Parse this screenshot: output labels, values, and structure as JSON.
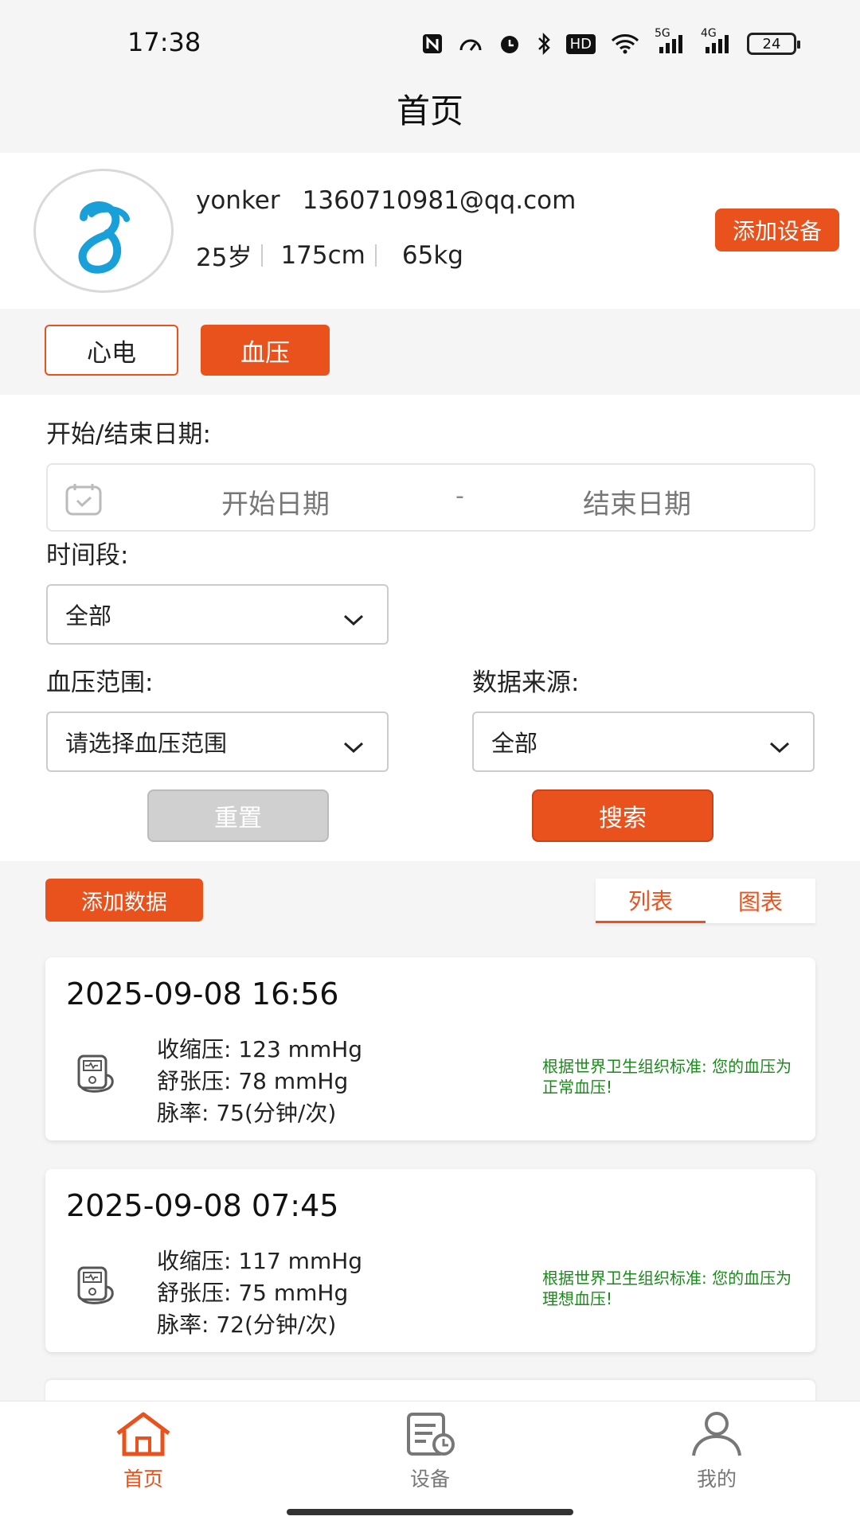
{
  "status_bar": {
    "time": "17:38",
    "battery": "24",
    "hd": "HD",
    "net5g": "5G",
    "net4g": "4G"
  },
  "header": {
    "title": "首页"
  },
  "profile": {
    "name": "yonker",
    "email": "1360710981@qq.com",
    "age": "25岁",
    "height": "175cm",
    "weight": "65kg",
    "add_device_label": "添加设备"
  },
  "tabs": [
    {
      "label": "心电",
      "active": false
    },
    {
      "label": "血压",
      "active": true
    }
  ],
  "filters": {
    "date_label": "开始/结束日期:",
    "start_placeholder": "开始日期",
    "dash": "-",
    "end_placeholder": "结束日期",
    "period_label": "时间段:",
    "period_value": "全部",
    "bp_range_label": "血压范围:",
    "bp_range_value": "请选择血压范围",
    "source_label": "数据来源:",
    "source_value": "全部",
    "reset_label": "重置",
    "search_label": "搜索"
  },
  "list_header": {
    "add_data_label": "添加数据",
    "view_list": "列表",
    "view_chart": "图表"
  },
  "records": [
    {
      "datetime": "2025-09-08 16:56",
      "systolic": "收缩压:  123 mmHg",
      "diastolic": "舒张压:  78 mmHg",
      "pulse": "脉率:  75(分钟/次)",
      "message": "根据世界卫生组织标准: 您的血压为正常血压!"
    },
    {
      "datetime": "2025-09-08 07:45",
      "systolic": "收缩压:  117 mmHg",
      "diastolic": "舒张压:  75 mmHg",
      "pulse": "脉率:  72(分钟/次)",
      "message": "根据世界卫生组织标准: 您的血压为理想血压!"
    }
  ],
  "bottom_nav": [
    {
      "label": "首页",
      "icon": "home-icon",
      "active": true
    },
    {
      "label": "设备",
      "icon": "device-icon",
      "active": false
    },
    {
      "label": "我的",
      "icon": "profile-icon",
      "active": false
    }
  ],
  "colors": {
    "accent": "#e9521d",
    "normal_text_green": "#1a8a1a",
    "inactive_nav": "#777777"
  }
}
